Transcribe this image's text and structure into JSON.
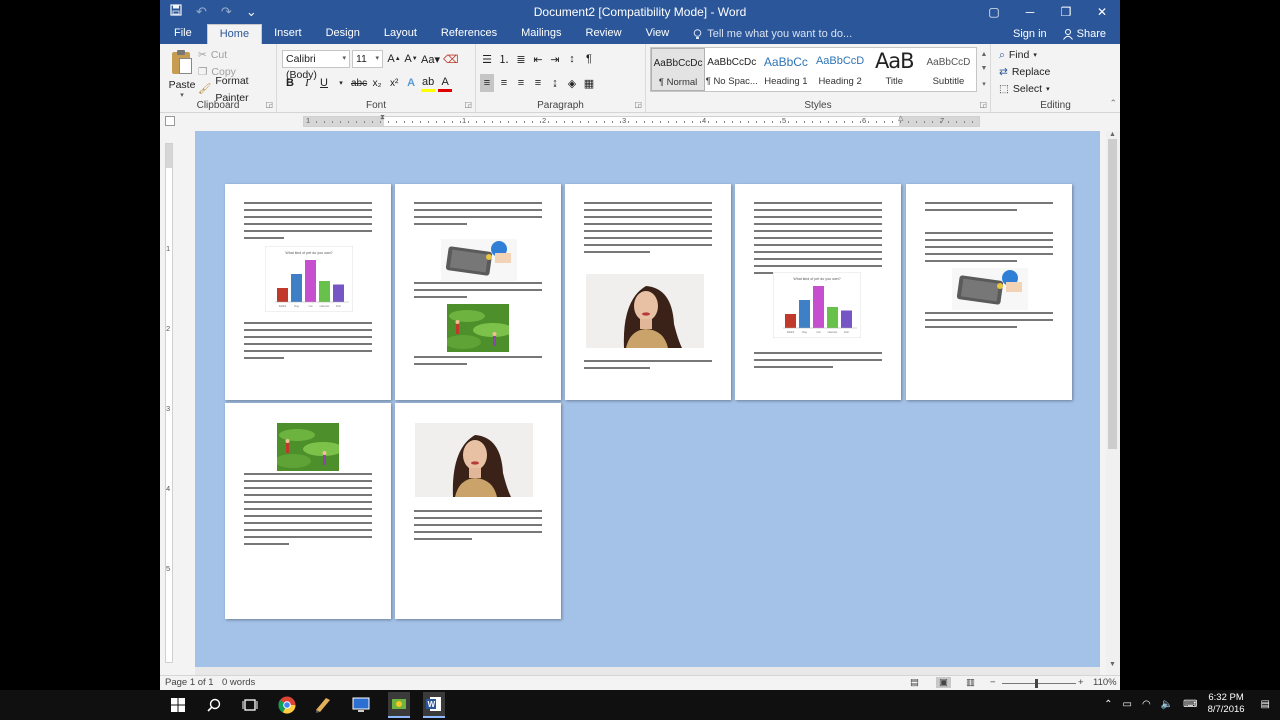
{
  "window": {
    "title": "Document2 [Compatibility Mode] - Word",
    "qat": {
      "save_icon": "save-icon",
      "undo": "↶",
      "redo": "↷",
      "customize": "⌄"
    },
    "controls": [
      "▢",
      "─",
      "❐",
      "✕"
    ]
  },
  "tabs": [
    "File",
    "Home",
    "Insert",
    "Design",
    "Layout",
    "References",
    "Mailings",
    "Review",
    "View"
  ],
  "active_tab": "Home",
  "tell_me": "Tell me what you want to do...",
  "sign_in": "Sign in",
  "share": "Share",
  "clipboard": {
    "label": "Clipboard",
    "paste": "Paste",
    "cut": "Cut",
    "copy": "Copy",
    "format_painter": "Format Painter"
  },
  "font": {
    "label": "Font",
    "family": "Calibri (Body)",
    "size": "11"
  },
  "paragraph": {
    "label": "Paragraph"
  },
  "styles": {
    "label": "Styles",
    "items": [
      {
        "preview": "AaBbCcDc",
        "name": "¶ Normal"
      },
      {
        "preview": "AaBbCcDc",
        "name": "¶ No Spac..."
      },
      {
        "preview": "AaBbCc",
        "name": "Heading 1"
      },
      {
        "preview": "AaBbCcD",
        "name": "Heading 2"
      },
      {
        "preview": "AaB",
        "name": "Title"
      },
      {
        "preview": "AaBbCcD",
        "name": "Subtitle"
      }
    ]
  },
  "editing": {
    "label": "Editing",
    "find": "Find",
    "replace": "Replace",
    "select": "Select"
  },
  "ruler_numbers": [
    "1",
    "1",
    "2",
    "3",
    "4",
    "5",
    "6",
    "7"
  ],
  "vruler_numbers": [
    "1",
    "2",
    "3",
    "4",
    "5"
  ],
  "pages": {
    "chart_title": "What kind of pet do you own?",
    "chart": {
      "categories": [
        "Rabbit",
        "Dog",
        "Cat",
        "Hamster",
        "Fish"
      ],
      "values": [
        2,
        4,
        6,
        3,
        2.5
      ],
      "colors": [
        "#c0392b",
        "#3f7fc6",
        "#c64fd0",
        "#68c14a",
        "#7656c5"
      ],
      "ylim": [
        0,
        6
      ]
    }
  },
  "status": {
    "page": "Page 1 of 1",
    "words": "0 words",
    "zoom": "110%",
    "zoom_minus": "−",
    "zoom_plus": "+"
  },
  "taskbar": {
    "time": "6:32 PM",
    "date": "8/7/2016"
  }
}
